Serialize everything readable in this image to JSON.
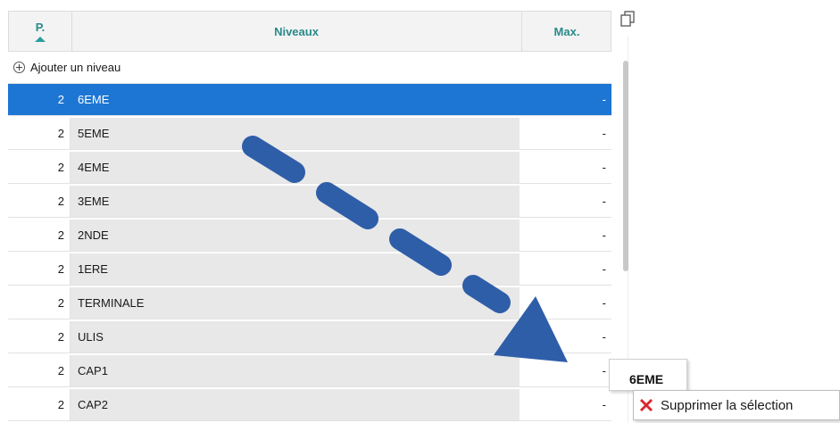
{
  "table": {
    "columns": {
      "p": "P.",
      "niveaux": "Niveaux",
      "max": "Max."
    },
    "add_label": "Ajouter un niveau",
    "rows": [
      {
        "p": "2",
        "niveau": "6EME",
        "max": "-",
        "selected": true
      },
      {
        "p": "2",
        "niveau": "5EME",
        "max": "-"
      },
      {
        "p": "2",
        "niveau": "4EME",
        "max": "-"
      },
      {
        "p": "2",
        "niveau": "3EME",
        "max": "-"
      },
      {
        "p": "2",
        "niveau": "2NDE",
        "max": "-"
      },
      {
        "p": "2",
        "niveau": "1ERE",
        "max": "-"
      },
      {
        "p": "2",
        "niveau": "TERMINALE",
        "max": "-"
      },
      {
        "p": "2",
        "niveau": "ULIS",
        "max": "-"
      },
      {
        "p": "2",
        "niveau": "CAP1",
        "max": "-"
      },
      {
        "p": "2",
        "niveau": "CAP2",
        "max": "-"
      }
    ]
  },
  "drag_tooltip": "6EME",
  "context_menu": {
    "delete_label": "Supprimer la sélection"
  },
  "colors": {
    "accent": "#1d76d4",
    "header_text": "#2a8a8a",
    "arrow": "#2f5ea8",
    "delete_icon": "#d9262b"
  },
  "icons": {
    "copy": "copy-icon",
    "add": "plus-circle-icon",
    "delete": "red-x-icon",
    "sort": "sort-up-icon"
  }
}
